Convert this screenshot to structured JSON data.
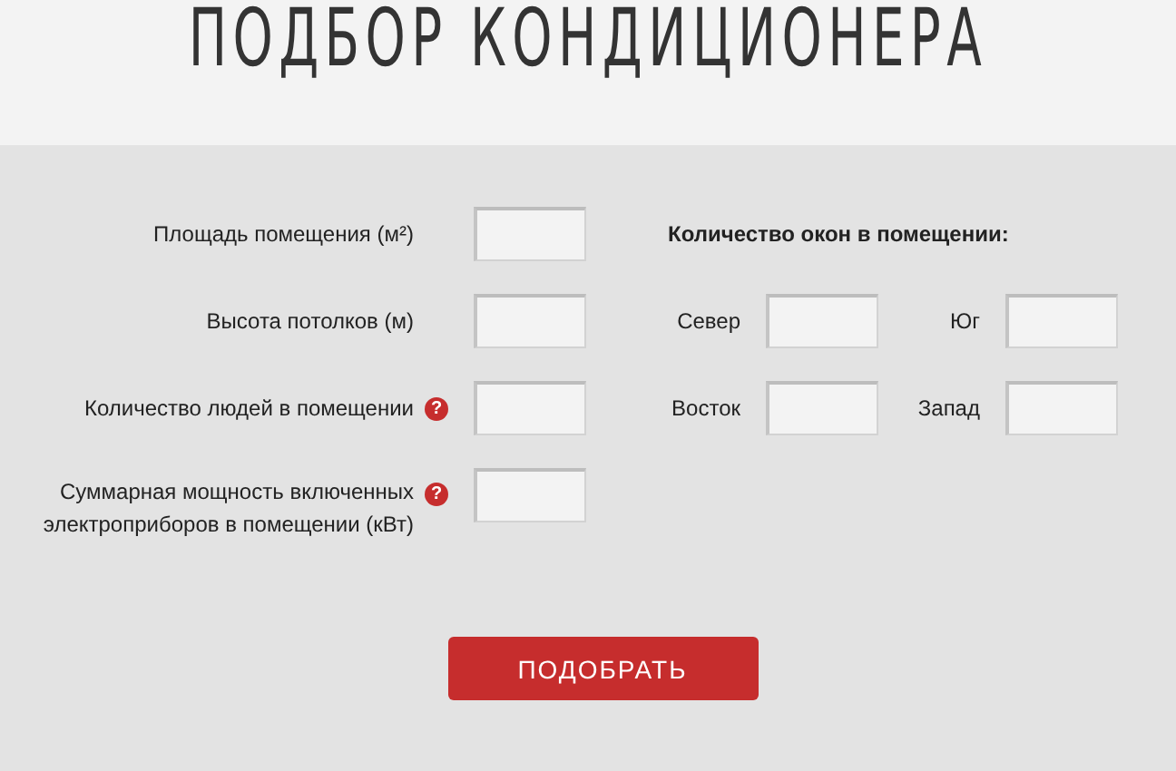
{
  "title": "ПОДБОР КОНДИЦИОНЕРА",
  "room_fields": [
    {
      "label": "Площадь помещения (м²)"
    },
    {
      "label": "Высота потолков (м)"
    },
    {
      "label": "Количество людей в помещении",
      "help_icon": "?"
    },
    {
      "label": "Суммарная мощность включенных электроприборов в помещении (кВт)",
      "help_icon": "?"
    }
  ],
  "windows": {
    "heading": "Количество окон в помещении:",
    "fields": [
      {
        "label": "Север"
      },
      {
        "label": "Юг"
      },
      {
        "label": "Восток"
      },
      {
        "label": "Запад"
      }
    ]
  },
  "submit_button": "ПОДОБРАТЬ"
}
